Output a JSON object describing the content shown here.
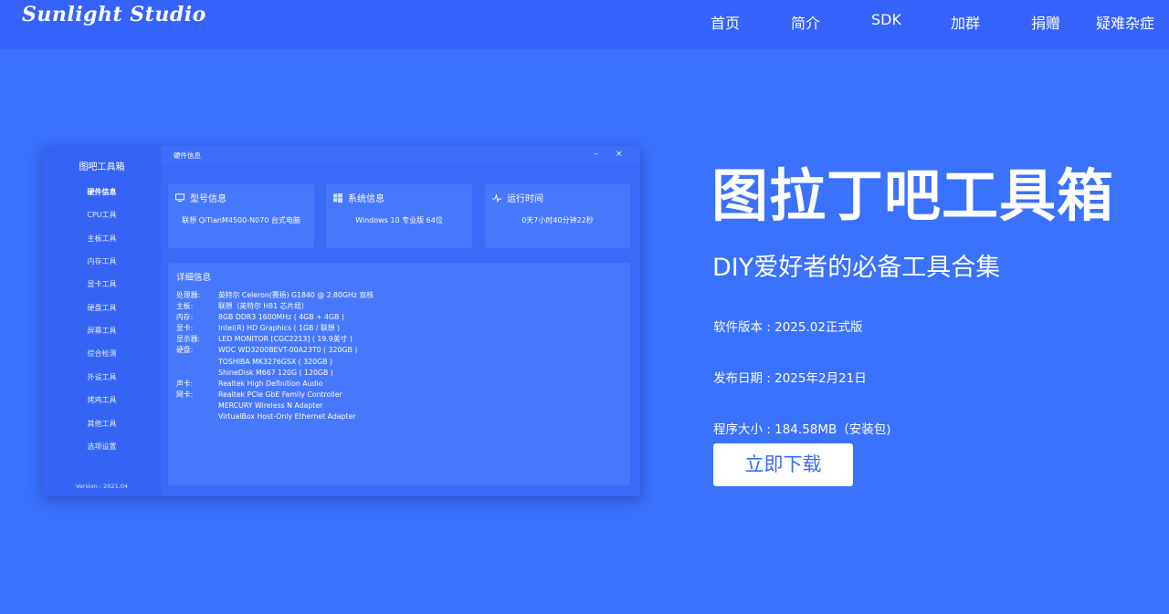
{
  "header": {
    "logo": "Sunlight Studio",
    "nav": [
      "首页",
      "简介",
      "SDK",
      "加群",
      "捐赠",
      "疑难杂症"
    ]
  },
  "app": {
    "title": "图吧工具箱",
    "sidebar": [
      "硬件信息",
      "CPU工具",
      "主板工具",
      "内存工具",
      "显卡工具",
      "硬盘工具",
      "屏幕工具",
      "综合检测",
      "外设工具",
      "烤鸡工具",
      "其他工具",
      "选项设置"
    ],
    "version": "Version : 2021.04",
    "window_title": "硬件信息",
    "win_min": "–",
    "win_close": "×",
    "cards": [
      {
        "title": "型号信息",
        "icon": "monitor-icon",
        "value": "联想 QiTianM4500-N070 台式电脑"
      },
      {
        "title": "系统信息",
        "icon": "windows-icon",
        "value": "Windows 10 专业版 64位"
      },
      {
        "title": "运行时间",
        "icon": "pulse-icon",
        "value": "0天7小时40分钟22秒"
      }
    ],
    "detail": {
      "title": "详细信息",
      "rows": [
        {
          "k": "处理器:",
          "v": "英特尔 Celeron(赛扬) G1840 @ 2.80GHz 双核"
        },
        {
          "k": "主板:",
          "v": "联想（英特尔 H81 芯片组）"
        },
        {
          "k": "内存:",
          "v": "8GB DDR3 1600MHz ( 4GB + 4GB )"
        },
        {
          "k": "显卡:",
          "v": "Intel(R) HD Graphics ( 1GB / 联想 )"
        },
        {
          "k": "显示器:",
          "v": "LED MONITOR [CGC2213] ( 19.9英寸 )"
        },
        {
          "k": "硬盘:",
          "v": "WDC WD3200BEVT-00A23T0 ( 320GB )"
        },
        {
          "k": "",
          "v": "TOSHIBA MK3276GSX ( 320GB )"
        },
        {
          "k": "",
          "v": "ShineDisk M667 120G ( 120GB )"
        },
        {
          "k": "声卡:",
          "v": "Realtek High Definition Audio"
        },
        {
          "k": "网卡:",
          "v": "Realtek PCIe GbE Family Controller"
        },
        {
          "k": "",
          "v": "MERCURY Wireless N Adapter"
        },
        {
          "k": "",
          "v": "VirtualBox Host-Only Ethernet Adapter"
        }
      ]
    }
  },
  "hero": {
    "title": "图拉丁吧工具箱",
    "subtitle": "DIY爱好者的必备工具合集",
    "version": "软件版本 : 2025.02正式版",
    "date": "发布日期 : 2025年2月21日",
    "size": "程序大小 : 184.58MB（安装包)",
    "download": "立即下载"
  },
  "colors": {
    "background": "#3a71fd",
    "topbar": "#3462fb",
    "accent": "#3a6af8"
  }
}
